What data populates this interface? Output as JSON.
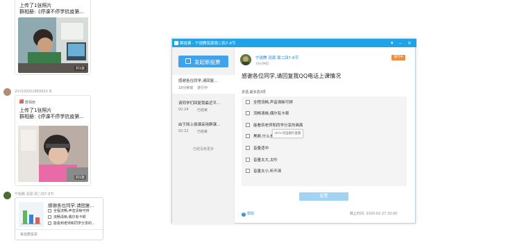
{
  "chat": {
    "card1": {
      "line1": "上传了1张照片",
      "line2": "群相册:《停课不停学抗疫第...",
      "photo_count": "共1张"
    },
    "sender2": "201930002889920 本",
    "card2": {
      "meta": "群相册",
      "line1": "上传了1张照片",
      "line2": "群相册:《停课不停学抗疫第...",
      "photo_count": "共1张"
    },
    "sender3": "宁锐腾 润源 周二四7-8节",
    "vote_card": {
      "title": "感谢各位同学,请回复...",
      "opt1": "全程流畅,声音清晰可辨",
      "opt2": "流畅清晰,偶尔有卡顿",
      "opt3": "能看到老师和同学分享的...",
      "footer": "来自群投票"
    }
  },
  "dialog": {
    "title": "群投票 - 宁锐腾润源周二四7-8节",
    "new_vote_label": "发起新投票",
    "votes": [
      {
        "title": "感谢各位同学,请回复...",
        "date": "18分钟前",
        "status": "进行中"
      },
      {
        "title": "请同学们回复我最近平...",
        "date": "02-24",
        "status": "已结束"
      },
      {
        "title": "由于网上授课采用群课...",
        "date": "02-22",
        "status": "已结束"
      }
    ],
    "no_more": "已经没有更多",
    "author": "宁锐腾 润源 周二四7-8节",
    "author_time": "18分钟前",
    "status_badge": "进行中",
    "question": "感谢各位同学,请回复我QQ电话上课情况",
    "multi_hint": "多选,最多选3项",
    "options": [
      "全程流畅,声音清晰可辨",
      "流畅清晰,偶尔有卡顿",
      "能看到老师和同学分享的画面",
      "黑屏,什么也看不见",
      "音量适中",
      "音量太大,太吵",
      "音量太小,听不清"
    ],
    "tooltip": "ctrl+点击图片查看",
    "vote_button": "投票",
    "help_link": "帮助",
    "deadline": "截止时间: 2020-02-27 20:00"
  },
  "colors": {
    "titlebar": "#1ea3e8",
    "primary_button": "#3fa2ec",
    "status_badge": "#f08c3c"
  }
}
